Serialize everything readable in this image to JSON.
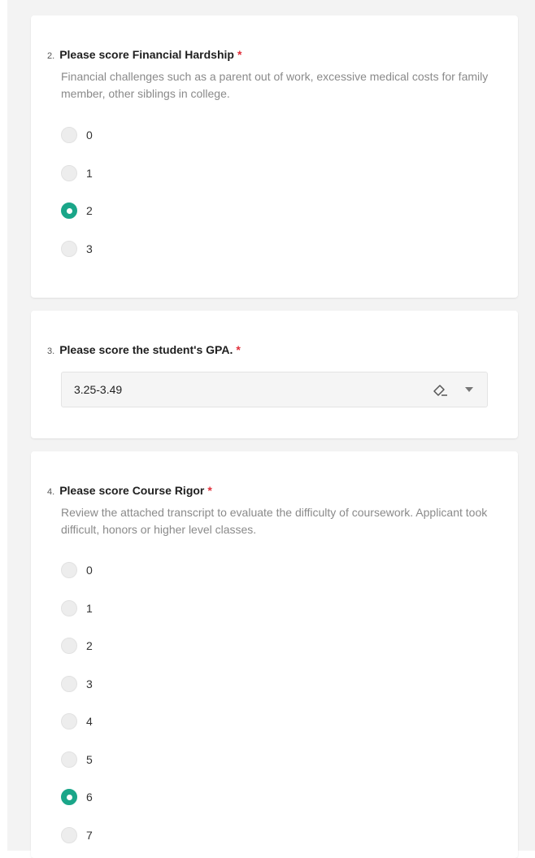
{
  "questions": [
    {
      "number": "2.",
      "title": "Please score Financial Hardship",
      "required": "*",
      "description": "Financial challenges such as a parent out of work, excessive medical costs for family member, other siblings in college.",
      "options": [
        "0",
        "1",
        "2",
        "3"
      ],
      "selected": "2"
    },
    {
      "number": "3.",
      "title": "Please score the student's GPA.",
      "required": "*",
      "select_value": "3.25-3.49",
      "icons": {
        "clear": "eraser-icon",
        "dropdown": "chevron-down-icon"
      }
    },
    {
      "number": "4.",
      "title": "Please score Course Rigor",
      "required": "*",
      "description": "Review the attached transcript to evaluate the difficulty of coursework. Applicant took difficult, honors or higher level classes.",
      "options": [
        "0",
        "1",
        "2",
        "3",
        "4",
        "5",
        "6",
        "7"
      ],
      "selected": "6"
    }
  ],
  "colors": {
    "accent": "#1aa689",
    "required": "#e02f3a",
    "background": "#f3f3f3"
  }
}
